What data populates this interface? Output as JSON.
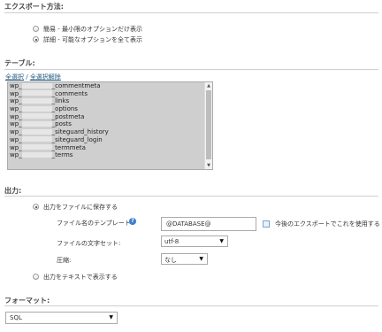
{
  "export_method": {
    "title": "エクスポート方法:",
    "options": [
      {
        "label": "簡易 - 最小限のオプションだけ表示",
        "selected": false
      },
      {
        "label": "詳細 - 可能なオプションを全て表示",
        "selected": true
      }
    ]
  },
  "tables": {
    "title": "テーブル:",
    "select_all": "全選択",
    "separator": " / ",
    "deselect_all": "全選択解除",
    "items": [
      {
        "prefix": "wp_",
        "suffix": "_commentmeta"
      },
      {
        "prefix": "wp_",
        "suffix": "_comments"
      },
      {
        "prefix": "wp_",
        "suffix": "_links"
      },
      {
        "prefix": "wp_",
        "suffix": "_options"
      },
      {
        "prefix": "wp_",
        "suffix": "_postmeta"
      },
      {
        "prefix": "wp_",
        "suffix": "_posts"
      },
      {
        "prefix": "wp_",
        "suffix": "_siteguard_history"
      },
      {
        "prefix": "wp_",
        "suffix": "_siteguard_login"
      },
      {
        "prefix": "wp_",
        "suffix": "_termmeta"
      },
      {
        "prefix": "wp_",
        "suffix": "_terms"
      }
    ]
  },
  "output": {
    "title": "出力:",
    "save_to_file": "出力をファイルに保存する",
    "filename_template_label": "ファイル名のテンプレート:",
    "filename_template_value": "@DATABASE@",
    "use_for_future": "今後のエクスポートでこれを使用する",
    "charset_label": "ファイルの文字セット:",
    "charset_value": "utf-8",
    "compression_label": "圧縮:",
    "compression_value": "なし",
    "show_as_text": "出力をテキストで表示する"
  },
  "format": {
    "title": "フォーマット:",
    "value": "SQL"
  },
  "icons": {
    "help": "help-icon",
    "dropdown": "chevron-down-icon"
  },
  "colors": {
    "link": "#235a81",
    "help_icon": "#3d7fd0",
    "list_selected_bg": "#cfcfcf"
  }
}
